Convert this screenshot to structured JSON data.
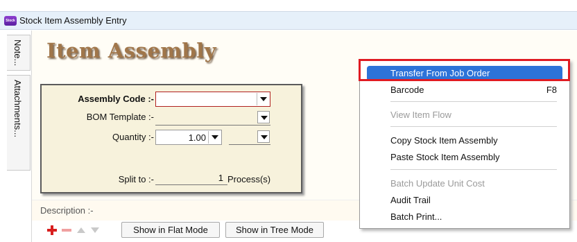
{
  "window": {
    "title": "Stock Item Assembly Entry",
    "app_icon_text": "Stock"
  },
  "side_tabs": [
    {
      "label": "Note..."
    },
    {
      "label": "Attachments..."
    }
  ],
  "form": {
    "heading": "Item Assembly",
    "assembly_code_label": "Assembly Code :-",
    "assembly_code_value": "",
    "bom_template_label": "BOM Template :-",
    "bom_template_value": "",
    "quantity_label": "Quantity :-",
    "quantity_value": "1.00",
    "quantity_unit_value": "",
    "split_label": "Split to :-",
    "split_value": "1",
    "split_unit": "Process(s)",
    "description_label": "Description :-"
  },
  "toolbar": {
    "flat_mode_label": "Show in Flat Mode",
    "tree_mode_label": "Show in Tree Mode"
  },
  "context_menu": {
    "items": [
      {
        "label": "Transfer From Job Order",
        "shortcut": "",
        "state": "selected"
      },
      {
        "label": "Barcode",
        "shortcut": "F8",
        "state": "enabled"
      },
      {
        "label": "View Item Flow",
        "shortcut": "",
        "state": "disabled"
      },
      {
        "label": "Copy Stock Item Assembly",
        "shortcut": "",
        "state": "enabled"
      },
      {
        "label": "Paste Stock Item Assembly",
        "shortcut": "",
        "state": "enabled"
      },
      {
        "label": "Batch Update Unit Cost",
        "shortcut": "",
        "state": "disabled"
      },
      {
        "label": "Audit Trail",
        "shortcut": "",
        "state": "enabled"
      },
      {
        "label": "Batch Print...",
        "shortcut": "",
        "state": "enabled"
      }
    ]
  },
  "colors": {
    "highlight": "#2d73d8",
    "annotation_box": "#e01b22",
    "heading": "#a0764a",
    "panel_bg": "#f7f2dc"
  }
}
